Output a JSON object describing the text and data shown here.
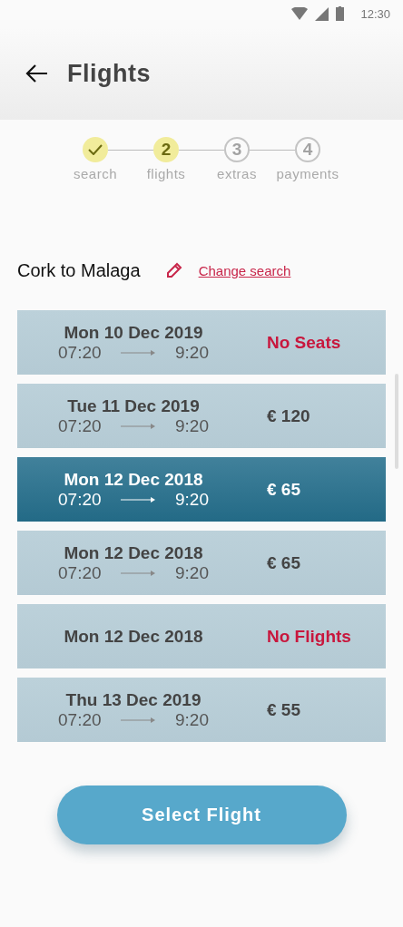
{
  "status_bar": {
    "time": "12:30"
  },
  "header": {
    "title": "Flights"
  },
  "steps": [
    {
      "label": "search",
      "done": true,
      "current": false
    },
    {
      "label": "flights",
      "number": "2",
      "done": false,
      "current": true
    },
    {
      "label": "extras",
      "number": "3",
      "done": false,
      "current": false
    },
    {
      "label": "payments",
      "number": "4",
      "done": false,
      "current": false
    }
  ],
  "route": {
    "title": "Cork to Malaga",
    "link": "Change search"
  },
  "flights": [
    {
      "date": "Mon 10 Dec 2019",
      "depart": "07:20",
      "arrive": "9:20",
      "kind": "unavailable",
      "price": "No Seats",
      "selected": false
    },
    {
      "date": "Tue 11 Dec 2019",
      "depart": "07:20",
      "arrive": "9:20",
      "kind": "price",
      "price": "€ 120",
      "selected": false
    },
    {
      "date": "Mon 12 Dec 2018",
      "depart": "07:20",
      "arrive": "9:20",
      "kind": "price",
      "price": "€ 65",
      "selected": true
    },
    {
      "date": "Mon 12 Dec 2018",
      "depart": "07:20",
      "arrive": "9:20",
      "kind": "price",
      "price": "€ 65",
      "selected": false
    },
    {
      "date": "Mon 12 Dec 2018",
      "kind": "unavailable",
      "price": "No Flights",
      "selected": false
    },
    {
      "date": "Thu 13 Dec 2019",
      "depart": "07:20",
      "arrive": "9:20",
      "kind": "price",
      "price": "€ 55",
      "selected": false
    }
  ],
  "button": {
    "label": "Select Flight"
  }
}
